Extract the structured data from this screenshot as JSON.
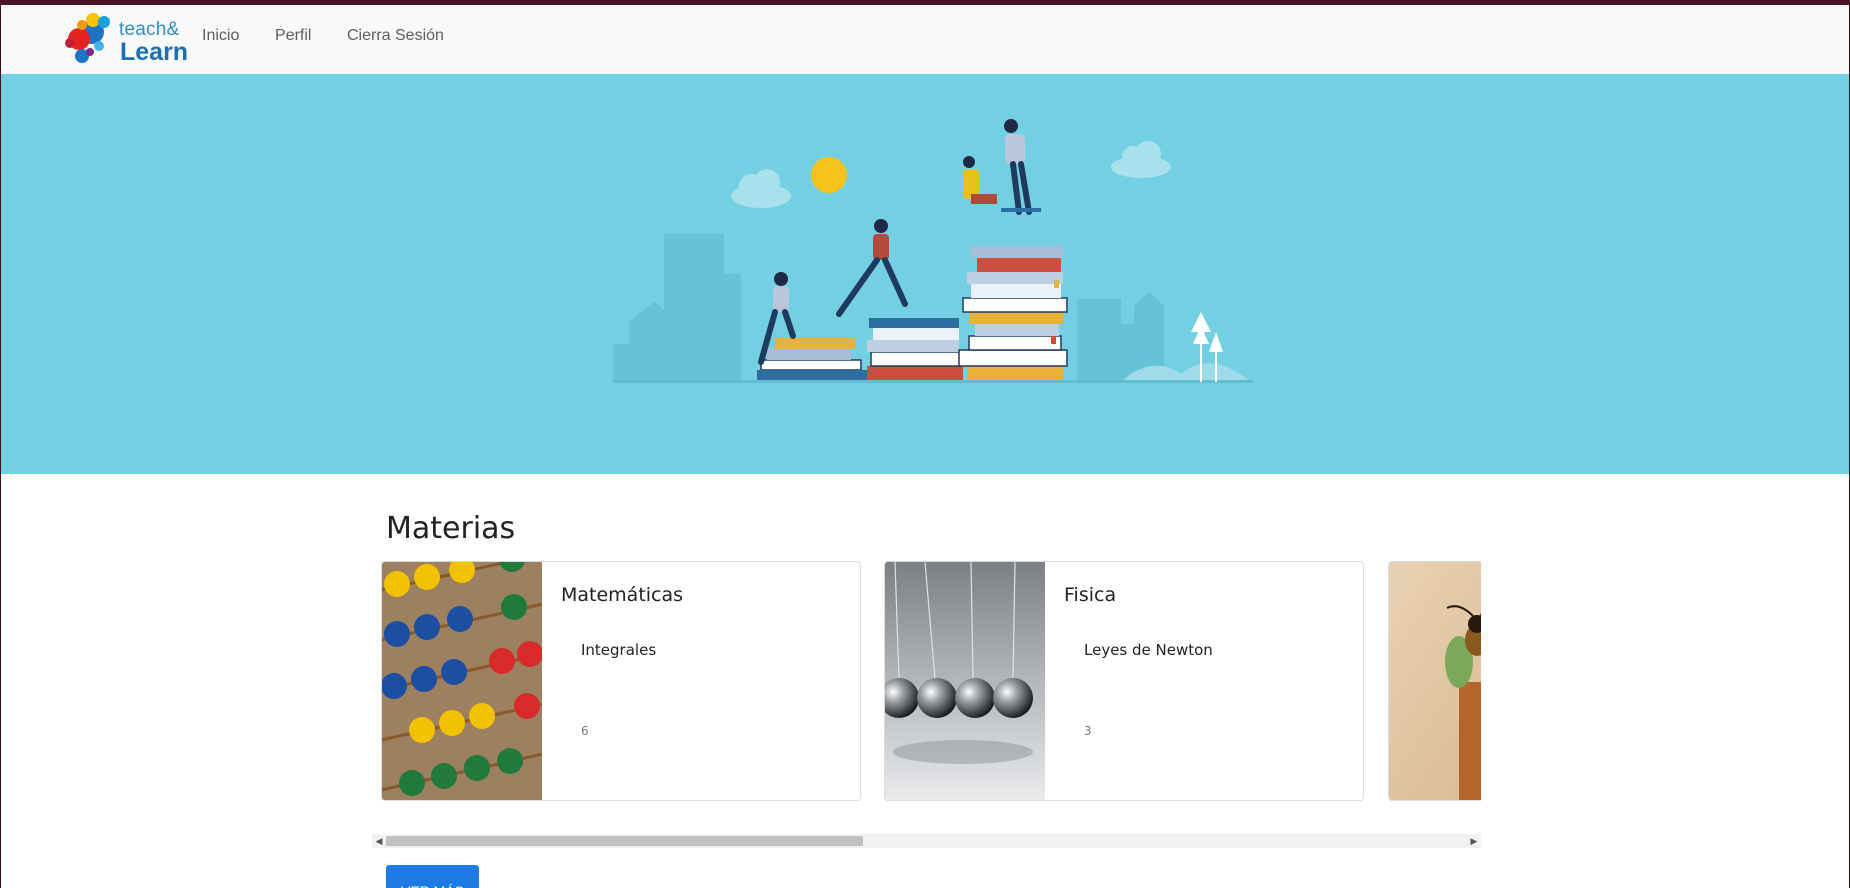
{
  "brand": {
    "line1": "teach&",
    "line2": "Learn"
  },
  "nav": {
    "items": [
      "Inicio",
      "Perfil",
      "Cierra Sesión"
    ]
  },
  "main": {
    "section_title": "Materias",
    "cards": [
      {
        "title": "Matemáticas",
        "topic": "Integrales",
        "count": "6",
        "image": "abacus-image"
      },
      {
        "title": "Fisica",
        "topic": "Leyes de Newton",
        "count": "3",
        "image": "newtons-cradle-image"
      },
      {
        "title": "",
        "topic": "",
        "count": "",
        "image": "insect-image"
      }
    ],
    "button_label": "VER MÁS"
  },
  "colors": {
    "hero_bg": "#72d0e2",
    "primary_button": "#1e7be6",
    "brand_blue": "#1c6fb5",
    "navbar_bg": "#f8f9fa"
  },
  "scroll": {
    "position_fraction": 0.44
  }
}
